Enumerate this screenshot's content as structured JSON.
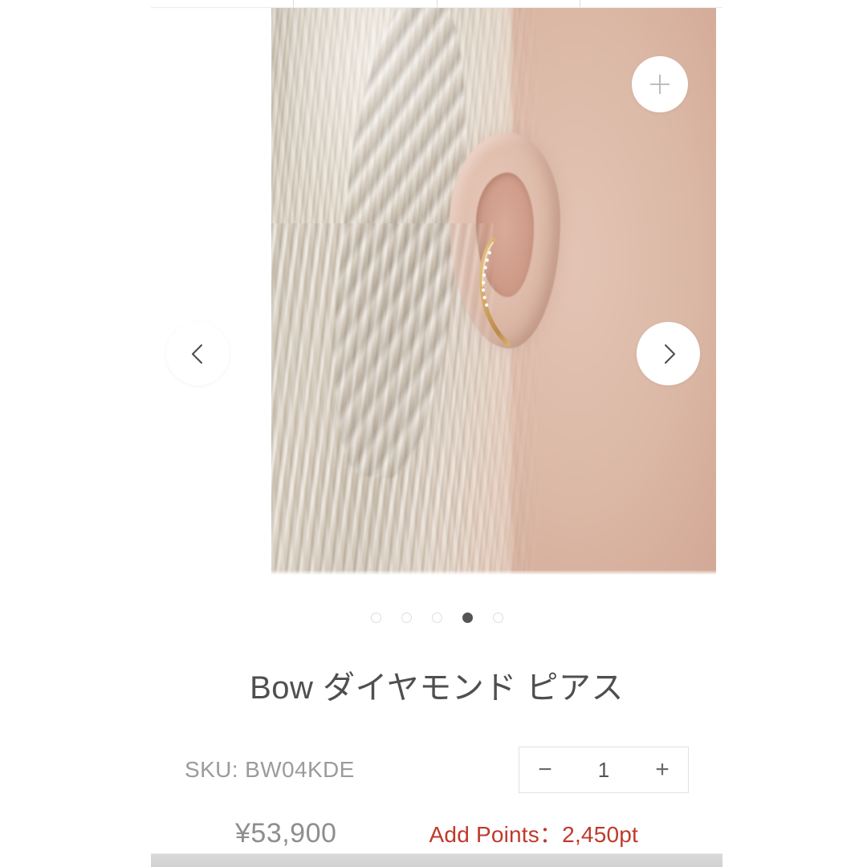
{
  "top_nav": {
    "cells": [
      "",
      "",
      "",
      ""
    ]
  },
  "gallery": {
    "zoom_button": {
      "icon": "plus-icon",
      "label": "+"
    },
    "prev_button": {
      "icon": "chevron-left-icon",
      "label": "‹"
    },
    "next_button": {
      "icon": "chevron-right-icon",
      "label": "›"
    },
    "image_alt": "Model wearing Bow diamond earring on ear with braided blonde hair",
    "dots": [
      {
        "index": 1,
        "active": false
      },
      {
        "index": 2,
        "active": false
      },
      {
        "index": 3,
        "active": false
      },
      {
        "index": 4,
        "active": true
      },
      {
        "index": 5,
        "active": false
      }
    ],
    "active_dot_color": "#555555",
    "inactive_dot_border": "#dddddd"
  },
  "product": {
    "title": "Bow ダイヤモンド ピアス",
    "sku_label": "SKU: BW04KDE",
    "price": "¥53,900",
    "points": "Add Points：2,450pt",
    "points_color": "#c0392b",
    "title_color": "#4f4f4f",
    "sku_color": "#9b9b9b",
    "price_color": "#8e8e8e"
  },
  "quantity": {
    "decrease_label": "−",
    "value": "1",
    "increase_label": "+"
  }
}
